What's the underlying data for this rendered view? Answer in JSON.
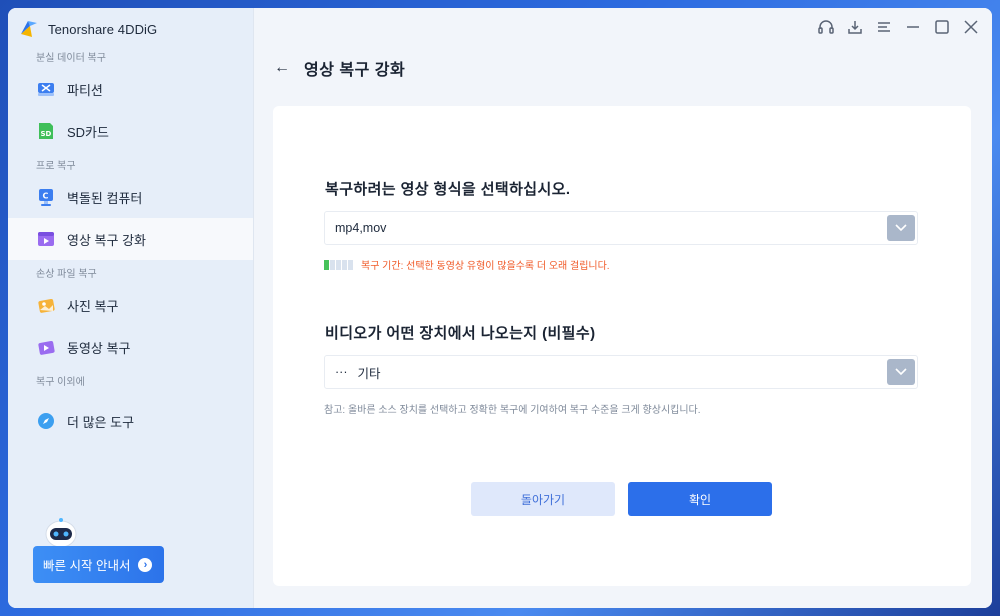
{
  "app": {
    "title": "Tenorshare 4DDiG"
  },
  "sidebar": {
    "sections": [
      {
        "label": "분실 데이터 복구",
        "items": [
          {
            "label": "파티션",
            "icon": "partition-icon"
          },
          {
            "label": "SD카드",
            "icon": "sd-card-icon"
          }
        ]
      },
      {
        "label": "프로 복구",
        "items": [
          {
            "label": "벽돌된 컴퓨터",
            "icon": "crashed-computer-icon"
          },
          {
            "label": "영상 복구 강화",
            "icon": "video-repair-icon",
            "active": true
          }
        ]
      },
      {
        "label": "손상 파일 복구",
        "items": [
          {
            "label": "사진 복구",
            "icon": "photo-icon"
          },
          {
            "label": "동영상 복구",
            "icon": "video-icon"
          }
        ]
      },
      {
        "label": "복구 이외에",
        "items": [
          {
            "label": "더 많은 도구",
            "icon": "compass-icon"
          }
        ]
      }
    ],
    "guide_button": "빠른 시작 안내서"
  },
  "titlebar": {
    "icons": [
      "headset-icon",
      "download-icon",
      "menu-icon",
      "minimize-icon",
      "maximize-icon",
      "close-icon"
    ]
  },
  "page": {
    "title": "영상 복구 강화",
    "q1": {
      "title": "복구하려는 영상 형식을 선택하십시오.",
      "value": "mp4,mov",
      "warning": "복구 기간: 선택한 동영상 유형이 많을수록 더 오래 걸립니다.",
      "meter_level": 0.2
    },
    "q2": {
      "title": "비디오가 어떤 장치에서 나오는지 (비필수)",
      "value_prefix": "···",
      "value": "기타",
      "note": "참고: 올바른 소스 장치를 선택하고 정확한 복구에 기여하여 복구 수준을 크게 향상시킵니다."
    },
    "back_button": "돌아가기",
    "confirm_button": "확인"
  },
  "colors": {
    "accent": "#2c6fea",
    "warning": "#f05a28",
    "meter_on": "#47c25a",
    "sidebar_bg": "#e6eef9"
  }
}
